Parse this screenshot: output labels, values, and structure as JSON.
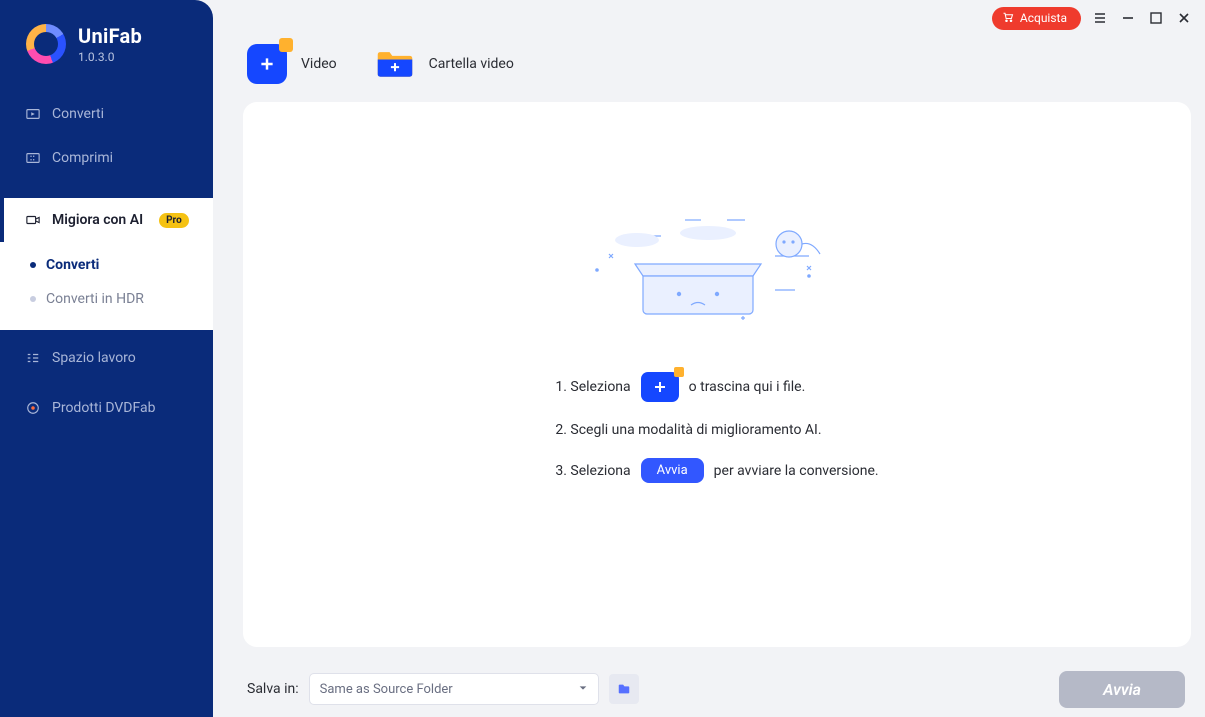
{
  "app": {
    "name": "UniFab",
    "version": "1.0.3.0"
  },
  "titlebar": {
    "buy": "Acquista"
  },
  "sidebar": {
    "items": [
      {
        "label": "Converti"
      },
      {
        "label": "Comprimi"
      },
      {
        "label": "Migiora con AI",
        "badge": "Pro",
        "children": [
          {
            "label": "Converti",
            "selected": true
          },
          {
            "label": "Converti in HDR"
          }
        ]
      },
      {
        "label": "Spazio lavoro"
      },
      {
        "label": "Prodotti DVDFab"
      }
    ]
  },
  "toolbar": {
    "video": "Video",
    "folder": "Cartella video"
  },
  "steps": {
    "s1a": "1. Seleziona",
    "s1b": "o trascina qui i file.",
    "s2": "2. Scegli una modalità di miglioramento AI.",
    "s3a": "3. Seleziona",
    "s3chip": "Avvia",
    "s3b": "per avviare la conversione."
  },
  "footer": {
    "saveLabel": "Salva in:",
    "saveValue": "Same as Source Folder",
    "start": "Avvia"
  }
}
